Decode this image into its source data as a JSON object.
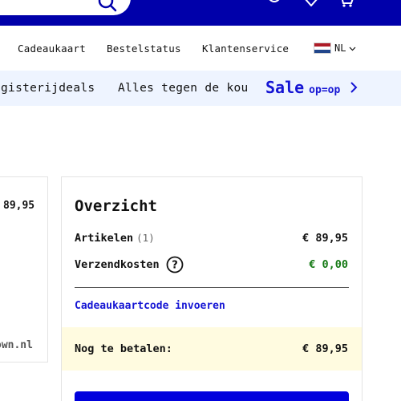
{
  "header": {
    "icons": [
      "search-icon",
      "user-icon",
      "heart-icon",
      "cart-icon"
    ],
    "brand_color": "#0000aa"
  },
  "nav": {
    "links": [
      "Cadeaukaart",
      "Bestelstatus",
      "Klantenservice"
    ],
    "language": "NL"
  },
  "promo": {
    "items": [
      "ogisterijdeals",
      "Alles tegen de kou"
    ],
    "sale_label": "Sale",
    "sale_sub": "op=op"
  },
  "left_card": {
    "price": "89,95",
    "domain": "own.nl"
  },
  "overview": {
    "title": "Overzicht",
    "articles_label": "Artikelen",
    "articles_count": "(1)",
    "articles_value": "€ 89,95",
    "shipping_label": "Verzendkosten",
    "shipping_value": "€ 0,00",
    "gift_code_link": "Cadeaukaartcode invoeren",
    "total_label": "Nog te betalen:",
    "total_value": "€ 89,95"
  },
  "colors": {
    "accent": "#1515d4",
    "free_shipping": "#157a15",
    "total_bg": "#fffbe0",
    "promo_bg": "#eef4ff"
  }
}
